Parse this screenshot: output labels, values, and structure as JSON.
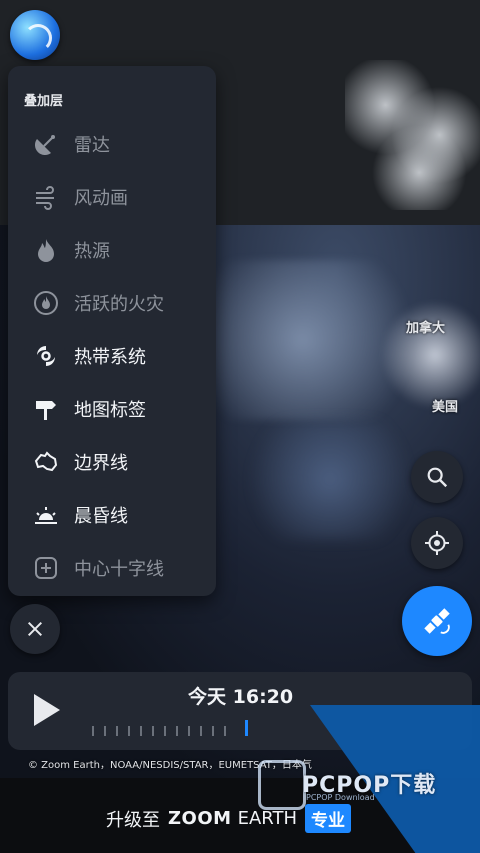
{
  "map": {
    "labels": [
      "加拿大",
      "美国"
    ],
    "copyright": "© Zoom Earth，NOAA/NESDIS/STAR，EUMETSAT，日本气"
  },
  "layers_panel": {
    "title": "叠加层",
    "items": [
      {
        "label": "雷达",
        "icon": "radar-dish-icon",
        "state": "dim"
      },
      {
        "label": "风动画",
        "icon": "wind-icon",
        "state": "dim"
      },
      {
        "label": "热源",
        "icon": "flame-icon",
        "state": "dim"
      },
      {
        "label": "活跃的火灾",
        "icon": "fire-circle-icon",
        "state": "dim"
      },
      {
        "label": "热带系统",
        "icon": "hurricane-icon",
        "state": "active"
      },
      {
        "label": "地图标签",
        "icon": "signpost-icon",
        "state": "active"
      },
      {
        "label": "边界线",
        "icon": "australia-outline-icon",
        "state": "active"
      },
      {
        "label": "晨昏线",
        "icon": "sunrise-icon",
        "state": "active"
      },
      {
        "label": "中心十字线",
        "icon": "plus-square-icon",
        "state": "dim"
      }
    ]
  },
  "timeline": {
    "day_label": "今天",
    "time": "16:20"
  },
  "banner": {
    "prefix": "升级至",
    "brand": "ZOOM",
    "brand2": "EARTH",
    "badge": "专业"
  },
  "watermark": {
    "text": "PCPOP下载",
    "sub": "PCPOP Download"
  },
  "colors": {
    "accent": "#1e88ff",
    "panel": "#232832"
  }
}
